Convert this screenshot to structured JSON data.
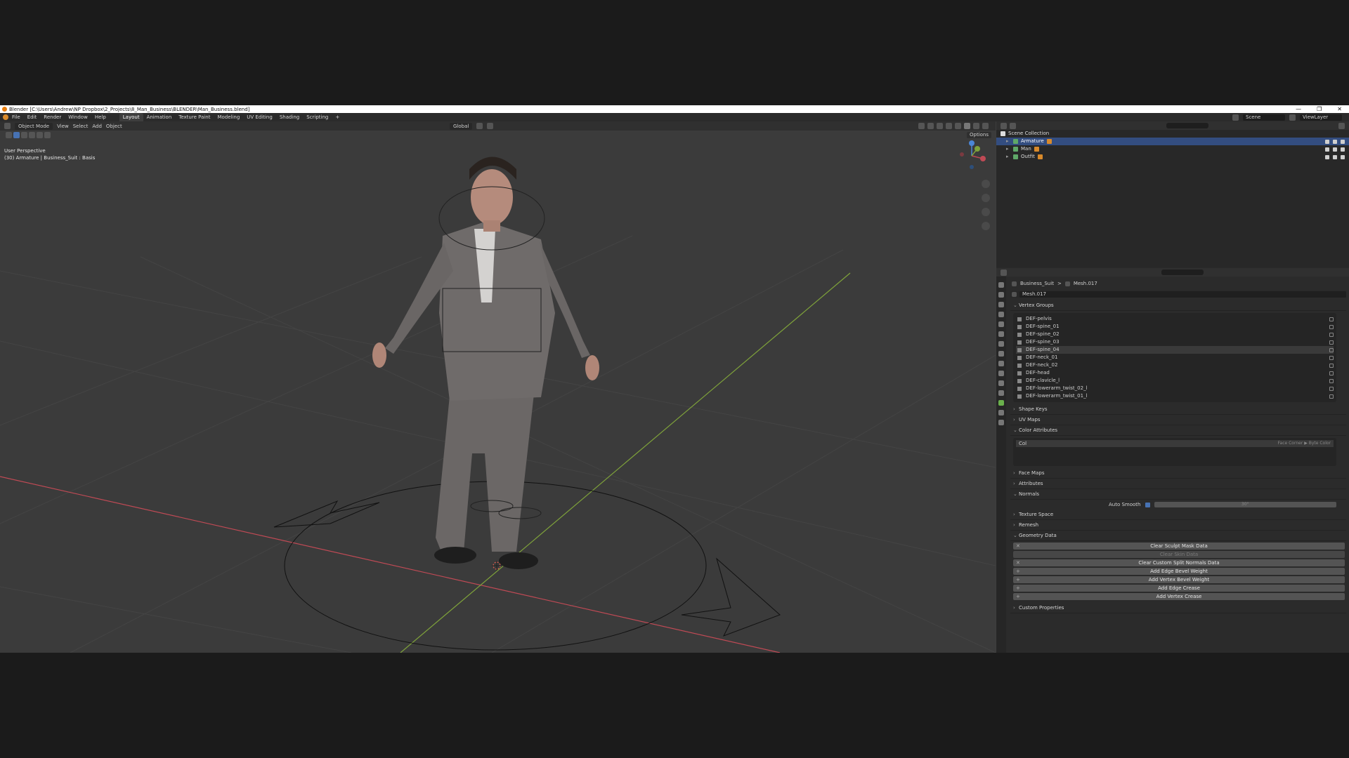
{
  "titlebar": {
    "title": "Blender [C:\\Users\\Andrew\\NP Dropbox\\2_Projects\\8_Man_Business\\BLENDER\\Man_Business.blend]",
    "controls": [
      "—",
      "❐",
      "✕"
    ]
  },
  "menu": [
    "File",
    "Edit",
    "Render",
    "Window",
    "Help"
  ],
  "tabs": [
    "Layout",
    "Animation",
    "Texture Paint",
    "Modeling",
    "UV Editing",
    "Shading",
    "Scripting",
    "+"
  ],
  "active_tab": "Layout",
  "scene_field": "Scene",
  "view_layer_field": "ViewLayer",
  "viewport": {
    "mode": "Object Mode",
    "menus": [
      "View",
      "Select",
      "Add",
      "Object"
    ],
    "transform_orientation": "Global",
    "options_label": "Options",
    "info_line1": "User Perspective",
    "info_line2": "(30) Armature | Business_Suit : Basis"
  },
  "outliner": {
    "root": "Scene Collection",
    "items": [
      {
        "label": "Armature",
        "selected": true,
        "color": "#5fa868"
      },
      {
        "label": "Man",
        "selected": false,
        "color": "#5fa868"
      },
      {
        "label": "Outfit",
        "selected": false,
        "color": "#5fa868"
      }
    ]
  },
  "properties": {
    "breadcrumb_object": "Business_Suit",
    "breadcrumb_sep": ">",
    "breadcrumb_mesh": "Mesh.017",
    "mesh_name": "Mesh.017",
    "sections": {
      "vertex_groups": "Vertex Groups",
      "shape_keys": "Shape Keys",
      "uv_maps": "UV Maps",
      "color_attributes": "Color Attributes",
      "face_maps": "Face Maps",
      "attributes": "Attributes",
      "normals": "Normals",
      "texture_space": "Texture Space",
      "remesh": "Remesh",
      "geometry_data": "Geometry Data",
      "custom_properties": "Custom Properties"
    },
    "vertex_groups": [
      "DEF-pelvis",
      "DEF-spine_01",
      "DEF-spine_02",
      "DEF-spine_03",
      "DEF-spine_04",
      "DEF-neck_01",
      "DEF-neck_02",
      "DEF-head",
      "DEF-clavicle_l",
      "DEF-lowerarm_twist_02_l",
      "DEF-lowerarm_twist_01_l"
    ],
    "selected_vertex_group": "DEF-spine_04",
    "color_attribute": "Col",
    "color_attribute_type": "Face Corner ▶ Byte Color",
    "auto_smooth_label": "Auto Smooth",
    "auto_smooth_angle": "30°",
    "geometry_buttons": [
      {
        "label": "Clear Sculpt Mask Data",
        "prefix": "✕",
        "enabled": true
      },
      {
        "label": "Clear Skin Data",
        "prefix": "",
        "enabled": false
      },
      {
        "label": "Clear Custom Split Normals Data",
        "prefix": "✕",
        "enabled": true
      },
      {
        "label": "Add Edge Bevel Weight",
        "prefix": "+",
        "enabled": true
      },
      {
        "label": "Add Vertex Bevel Weight",
        "prefix": "+",
        "enabled": true
      },
      {
        "label": "Add Edge Crease",
        "prefix": "+",
        "enabled": true
      },
      {
        "label": "Add Vertex Crease",
        "prefix": "+",
        "enabled": true
      }
    ]
  },
  "colors": {
    "accent": "#4772b3",
    "selection": "#334d80",
    "x_axis": "#c04a55",
    "y_axis": "#7fa33a",
    "z_axis": "#4b86d6"
  }
}
